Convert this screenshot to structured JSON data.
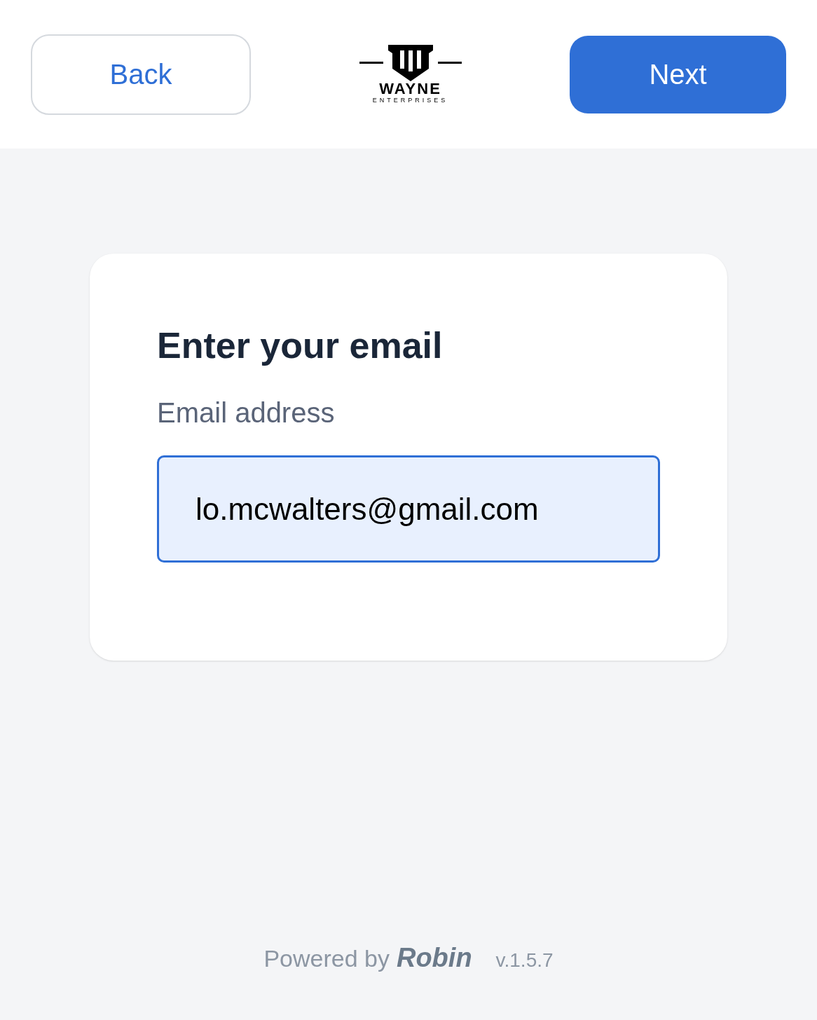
{
  "header": {
    "back_button": "Back",
    "logo": {
      "name": "WAYNE",
      "tagline": "ENTERPRISES"
    },
    "next_button": "Next"
  },
  "card": {
    "title": "Enter your email",
    "field": {
      "label": "Email address",
      "value": "lo.mcwalters@gmail.com",
      "focused": true
    }
  },
  "footer": {
    "powered_by": "Powered by",
    "brand": "Robin",
    "version": "v.1.5.7"
  }
}
